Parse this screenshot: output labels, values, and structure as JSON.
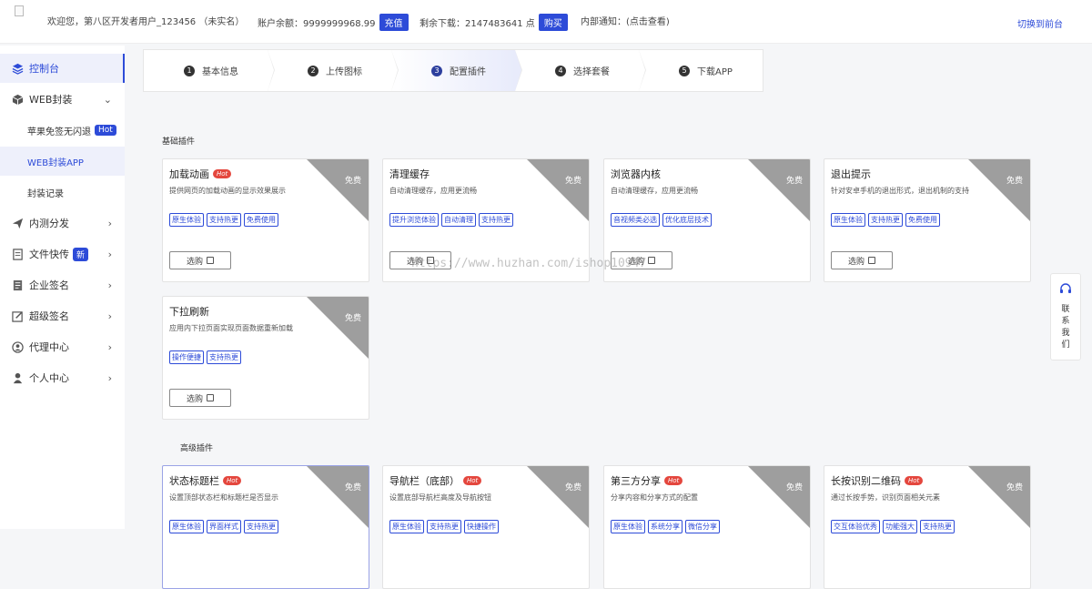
{
  "topbar": {
    "welcome": "欢迎您，第八区开发者用户_123456 （未实名）",
    "balance_label": "账户余额：9999999968.99",
    "recharge_button": "充值",
    "downloads_label": "剩余下载：2147483641 点",
    "buy_button": "购买",
    "notice": "内部通知：(点击查看)",
    "switch_link": "切换到前台"
  },
  "sidebar": {
    "items": [
      {
        "label": "控制台",
        "icon": "layers-icon"
      },
      {
        "label": "WEB封装",
        "icon": "box-icon"
      },
      {
        "label": "苹果免签无闪退",
        "badge": "Hot"
      },
      {
        "label": "WEB封装APP"
      },
      {
        "label": "封装记录"
      },
      {
        "label": "内测分发",
        "icon": "send-icon"
      },
      {
        "label": "文件快传",
        "icon": "file-icon",
        "badge": "新"
      },
      {
        "label": "企业签名",
        "icon": "document-icon"
      },
      {
        "label": "超级签名",
        "icon": "edit-icon"
      },
      {
        "label": "代理中心",
        "icon": "agent-icon"
      },
      {
        "label": "个人中心",
        "icon": "user-icon"
      }
    ]
  },
  "steps": [
    {
      "num": "1",
      "label": "基本信息"
    },
    {
      "num": "2",
      "label": "上传图标"
    },
    {
      "num": "3",
      "label": "配置插件"
    },
    {
      "num": "4",
      "label": "选择套餐"
    },
    {
      "num": "5",
      "label": "下载APP"
    }
  ],
  "sections": {
    "basic": "基础插件",
    "advanced": "高级插件"
  },
  "free_label": "免费",
  "hot_label": "Hot",
  "select_label": "选购",
  "basic_cards": [
    {
      "title": "加载动画",
      "hot": true,
      "desc": "提供网页的加载动画的显示效果展示",
      "tags": [
        "原生体验",
        "支持热更",
        "免费使用"
      ]
    },
    {
      "title": "清理缓存",
      "hot": false,
      "desc": "自动清理缓存，应用更流畅",
      "tags": [
        "提升浏览体验",
        "自动清理",
        "支持热更"
      ]
    },
    {
      "title": "浏览器内核",
      "hot": false,
      "desc": "自动清理缓存，应用更流畅",
      "tags": [
        "音视频类必选",
        "优化底层技术"
      ]
    },
    {
      "title": "退出提示",
      "hot": false,
      "desc": "针对安卓手机的退出形式，退出机制的支持",
      "tags": [
        "原生体验",
        "支持热更",
        "免费使用"
      ]
    },
    {
      "title": "下拉刷新",
      "hot": false,
      "desc": "应用内下拉页面实现页面数据重新加载",
      "tags": [
        "操作便捷",
        "支持热更"
      ]
    }
  ],
  "advanced_cards": [
    {
      "title": "状态标题栏",
      "hot": true,
      "desc": "设置顶部状态栏和标题栏是否显示",
      "tags": [
        "原生体验",
        "界面样式",
        "支持热更"
      ]
    },
    {
      "title": "导航栏（底部）",
      "hot": true,
      "desc": "设置底部导航栏高度及导航按钮",
      "tags": [
        "原生体验",
        "支持热更",
        "快捷操作"
      ]
    },
    {
      "title": "第三方分享",
      "hot": true,
      "desc": "分享内容和分享方式的配置",
      "tags": [
        "原生体验",
        "系统分享",
        "微信分享"
      ]
    },
    {
      "title": "长按识别二维码",
      "hot": true,
      "desc": "通过长按手势，识别页面相关元素",
      "tags": [
        "交互体验优秀",
        "功能强大",
        "支持热更"
      ]
    }
  ],
  "contact": {
    "chars": [
      "联",
      "系",
      "我",
      "们"
    ],
    "icon": "headset-icon"
  },
  "watermark": "https://www.huzhan.com/ishop10947"
}
